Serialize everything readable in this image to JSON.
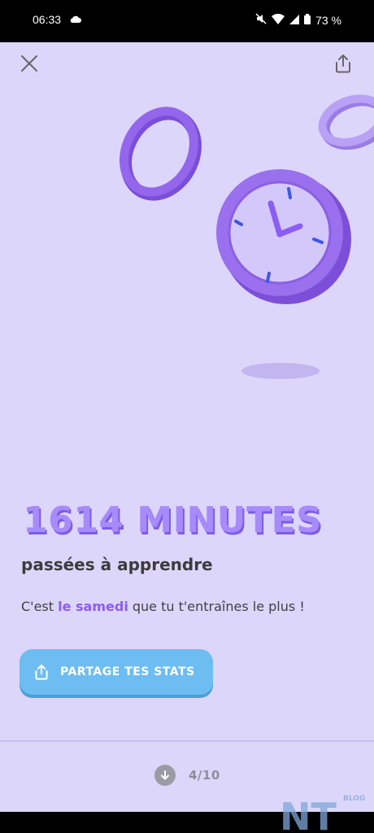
{
  "status": {
    "time": "06:33",
    "battery": "73 %"
  },
  "topbar": {
    "close_icon": "close-icon",
    "share_icon": "share-icon"
  },
  "stat": {
    "headline": "1614 MINUTES",
    "subtitle": "passées à apprendre",
    "desc_before": "C'est ",
    "desc_highlight": "le samedi",
    "desc_after": " que tu t'entraînes le plus !"
  },
  "share_button": {
    "label": "PARTAGE TES STATS"
  },
  "pager": {
    "text": "4/10",
    "icon": "arrow-down-icon"
  },
  "watermark": {
    "text": "NT",
    "sub": "BLOG"
  },
  "colors": {
    "background": "#ddd6fb",
    "accent": "#8b5cf6",
    "button": "#6dbdf2"
  }
}
